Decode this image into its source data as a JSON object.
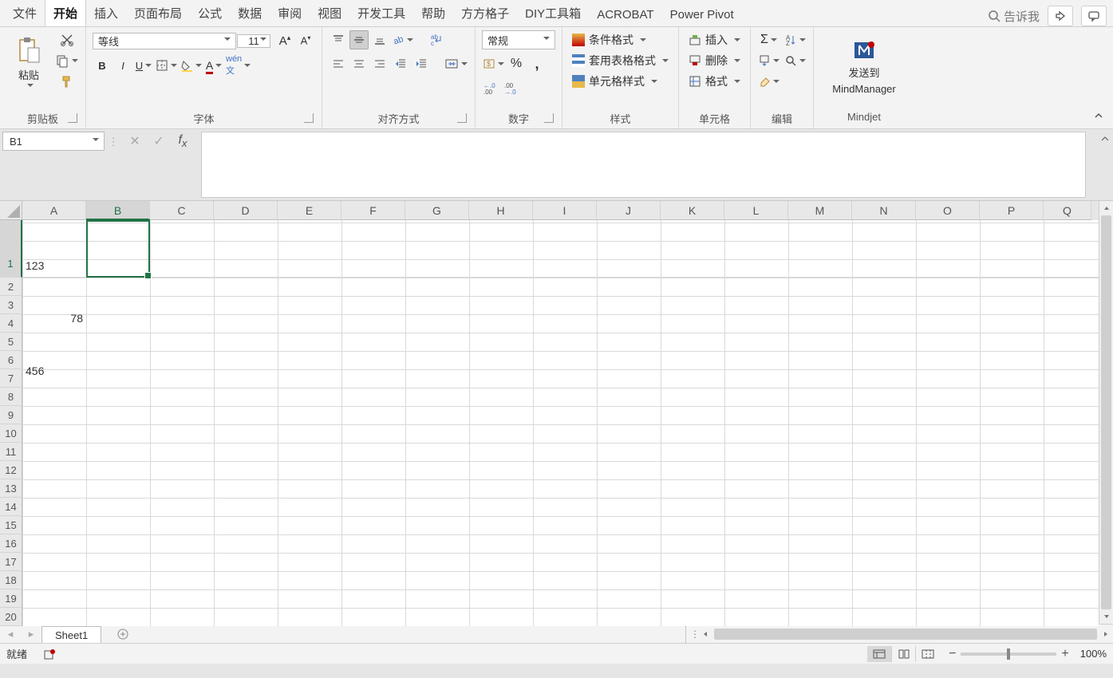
{
  "menu_tabs": [
    "文件",
    "开始",
    "插入",
    "页面布局",
    "公式",
    "数据",
    "审阅",
    "视图",
    "开发工具",
    "帮助",
    "方方格子",
    "DIY工具箱",
    "ACROBAT",
    "Power Pivot"
  ],
  "active_tab_index": 1,
  "tell_me": "告诉我",
  "ribbon": {
    "clipboard": {
      "label": "剪贴板",
      "paste": "粘贴"
    },
    "font": {
      "label": "字体",
      "name": "等线",
      "size": "11"
    },
    "align": {
      "label": "对齐方式"
    },
    "number": {
      "label": "数字",
      "format": "常规"
    },
    "styles": {
      "label": "样式",
      "cond": "条件格式",
      "table": "套用表格格式",
      "cell": "单元格样式"
    },
    "cells": {
      "label": "单元格",
      "insert": "插入",
      "delete": "删除",
      "format": "格式"
    },
    "editing": {
      "label": "编辑"
    },
    "mindjet": {
      "label": "Mindjet",
      "send1": "发送到",
      "send2": "MindManager"
    }
  },
  "namebox": "B1",
  "formula": "",
  "columns": [
    "A",
    "B",
    "C",
    "D",
    "E",
    "F",
    "G",
    "H",
    "I",
    "J",
    "K",
    "L",
    "M",
    "N",
    "O",
    "P",
    "Q"
  ],
  "rows": [
    "1",
    "2",
    "3",
    "4",
    "5",
    "6",
    "7",
    "8",
    "9",
    "10",
    "11",
    "12",
    "13",
    "14",
    "15",
    "16",
    "17",
    "18",
    "19",
    "20"
  ],
  "cellA1": {
    "line1": "123",
    "line2": "78",
    "line3": "456"
  },
  "selected_col_index": 1,
  "selected_row_index": 0,
  "sheet_tabs": [
    "Sheet1"
  ],
  "status": {
    "ready": "就绪",
    "zoom": "100%"
  }
}
